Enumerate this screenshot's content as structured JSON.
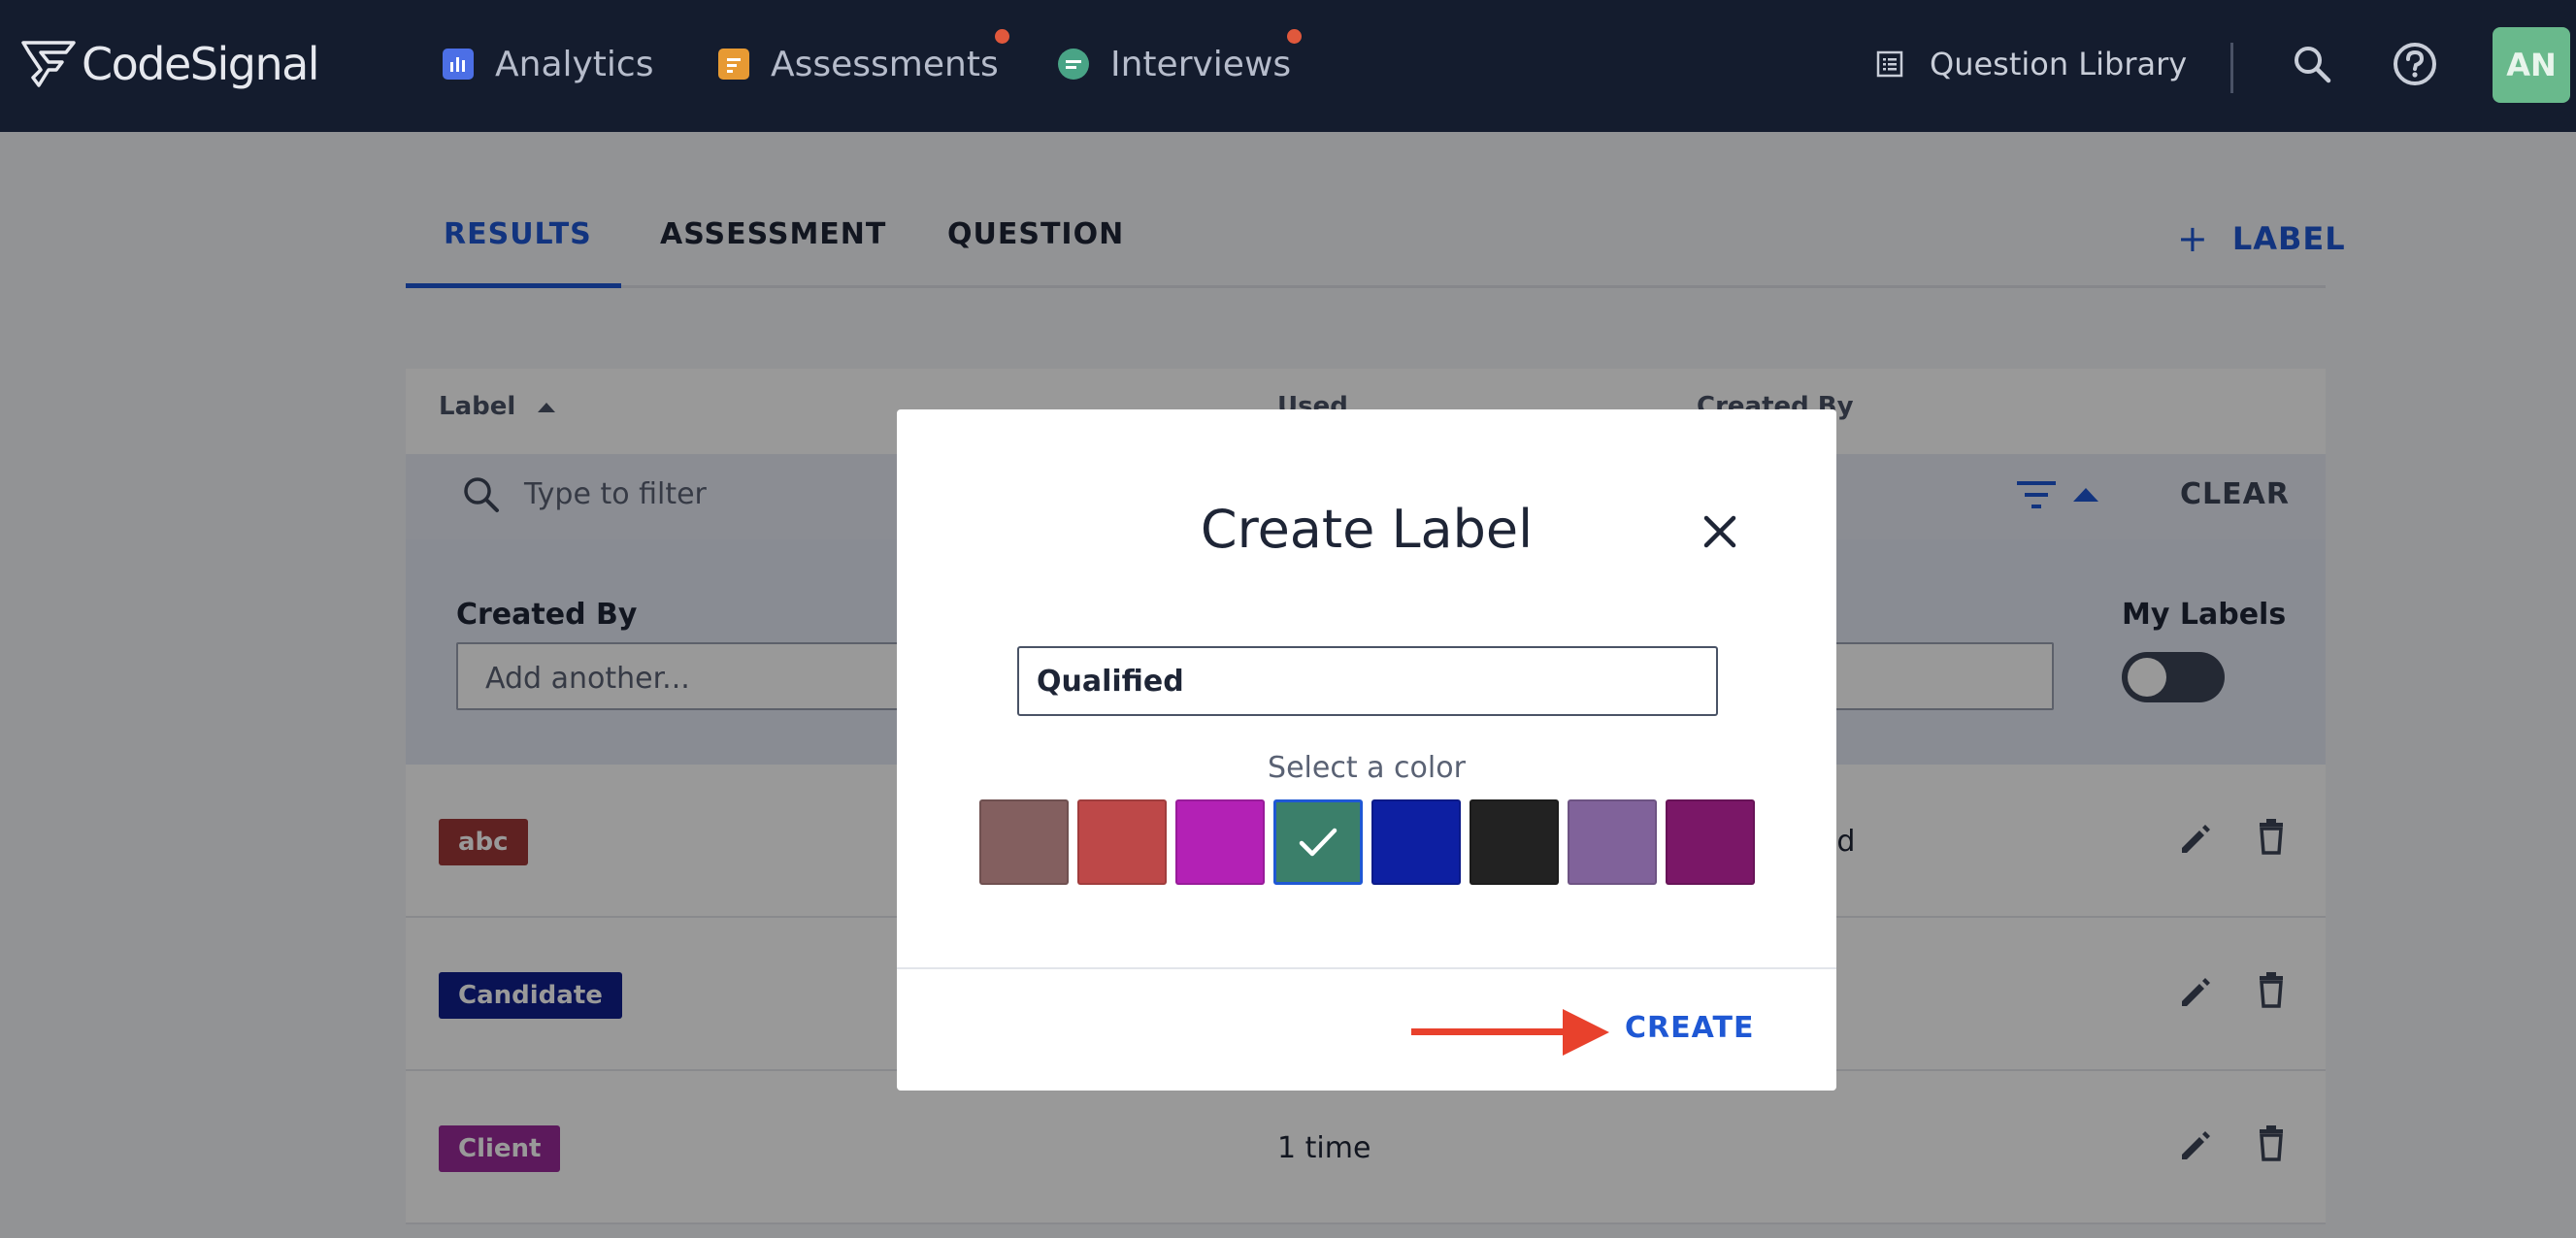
{
  "nav": {
    "logo_text": "CodeSignal",
    "items": [
      {
        "label": "Analytics",
        "icon": "bar-chart-icon",
        "color": "#4c6fe6",
        "badge": false
      },
      {
        "label": "Assessments",
        "icon": "clipboard-icon",
        "color": "#e79a33",
        "badge": true
      },
      {
        "label": "Interviews",
        "icon": "chat-icon",
        "color": "#49a486",
        "badge": true
      }
    ],
    "question_library": "Question Library",
    "avatar_initials": "AN"
  },
  "tabs": [
    {
      "label": "RESULTS",
      "active": true
    },
    {
      "label": "ASSESSMENT",
      "active": false
    },
    {
      "label": "QUESTION",
      "active": false
    }
  ],
  "add_label_button": "LABEL",
  "table": {
    "columns": [
      "Label",
      "Used",
      "Created By"
    ],
    "filter_placeholder": "Type to filter",
    "clear_label": "CLEAR",
    "advanced": {
      "created_by_label": "Created By",
      "created_by_placeholder": "Add another...",
      "my_labels_label": "My Labels",
      "my_labels_on": false
    },
    "rows": [
      {
        "label": "abc",
        "color": "#9e3838",
        "used": "",
        "created_by": "od"
      },
      {
        "label": "Candidate",
        "color": "#0f1f8c",
        "used": "",
        "created_by": ""
      },
      {
        "label": "Client",
        "color": "#9a2a9a",
        "used": "1 time",
        "created_by": ""
      }
    ]
  },
  "modal": {
    "title": "Create Label",
    "input_value": "Qualified",
    "select_color_label": "Select a color",
    "colors": [
      "#835f5f",
      "#bd4848",
      "#b321b5",
      "#3b7f6a",
      "#0d1fa2",
      "#222222",
      "#80629a",
      "#7a1767"
    ],
    "selected_color_index": 3,
    "create_label": "CREATE"
  }
}
